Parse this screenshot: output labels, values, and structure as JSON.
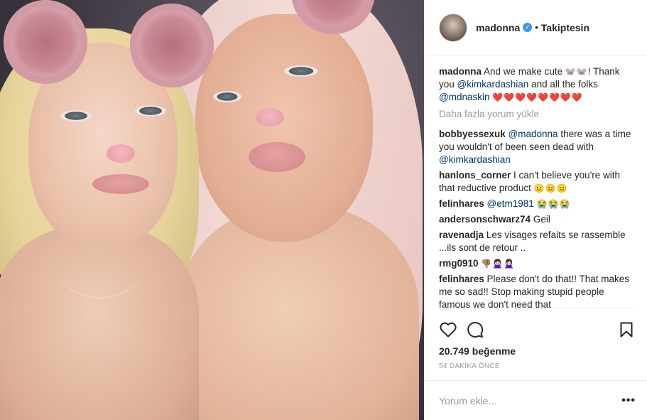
{
  "post": {
    "username": "madonna",
    "separator": "•",
    "follow_status": "Takiptesin",
    "caption": {
      "user": "madonna",
      "text_1": "And we make cute",
      "emoji_1": "🐭🐭",
      "text_2": "! Thank you",
      "mention_1": "@kimkardashian",
      "text_3": "and all the folks",
      "mention_2": "@mdnaskin",
      "emoji_2": "❤️❤️❤️❤️❤️❤️❤️❤️"
    },
    "load_more": "Daha fazla yorum yükle",
    "comments": [
      {
        "user": "bobbyessexuk",
        "mention": "@madonna",
        "text": "there was a time you wouldn't of been seen dead with",
        "mention2": "@kimkardashian"
      },
      {
        "user": "hanlons_corner",
        "text": "I can't believe you're with that reductive product",
        "emoji": "😐😐😐"
      },
      {
        "user": "felinhares",
        "mention": "@etm1981",
        "emoji": "😭😭😭"
      },
      {
        "user": "andersonschwarz74",
        "text": "Geil"
      },
      {
        "user": "ravenadja",
        "text": "Les visages refaits se rassemble ...ils sont de retour .."
      },
      {
        "user": "rmg0910",
        "emoji": "👎🏽🙅🏻‍♀️🙅🏻‍♀️"
      },
      {
        "user": "felinhares",
        "text": "Please don't do that!! That makes me so sad!! Stop making stupid people famous we don't need that"
      }
    ],
    "likes": "20.749 beğenme",
    "time": "54 DAKİKA ÖNCE",
    "comment_placeholder": "Yorum ekle...",
    "more_label": "•••"
  },
  "icons": {
    "like": "heart-outline-icon",
    "comment": "speech-bubble-icon",
    "save": "bookmark-icon",
    "verified": "verified-badge-icon"
  },
  "colors": {
    "verified": "#3897f0",
    "mention": "#003569",
    "muted": "#999999"
  }
}
